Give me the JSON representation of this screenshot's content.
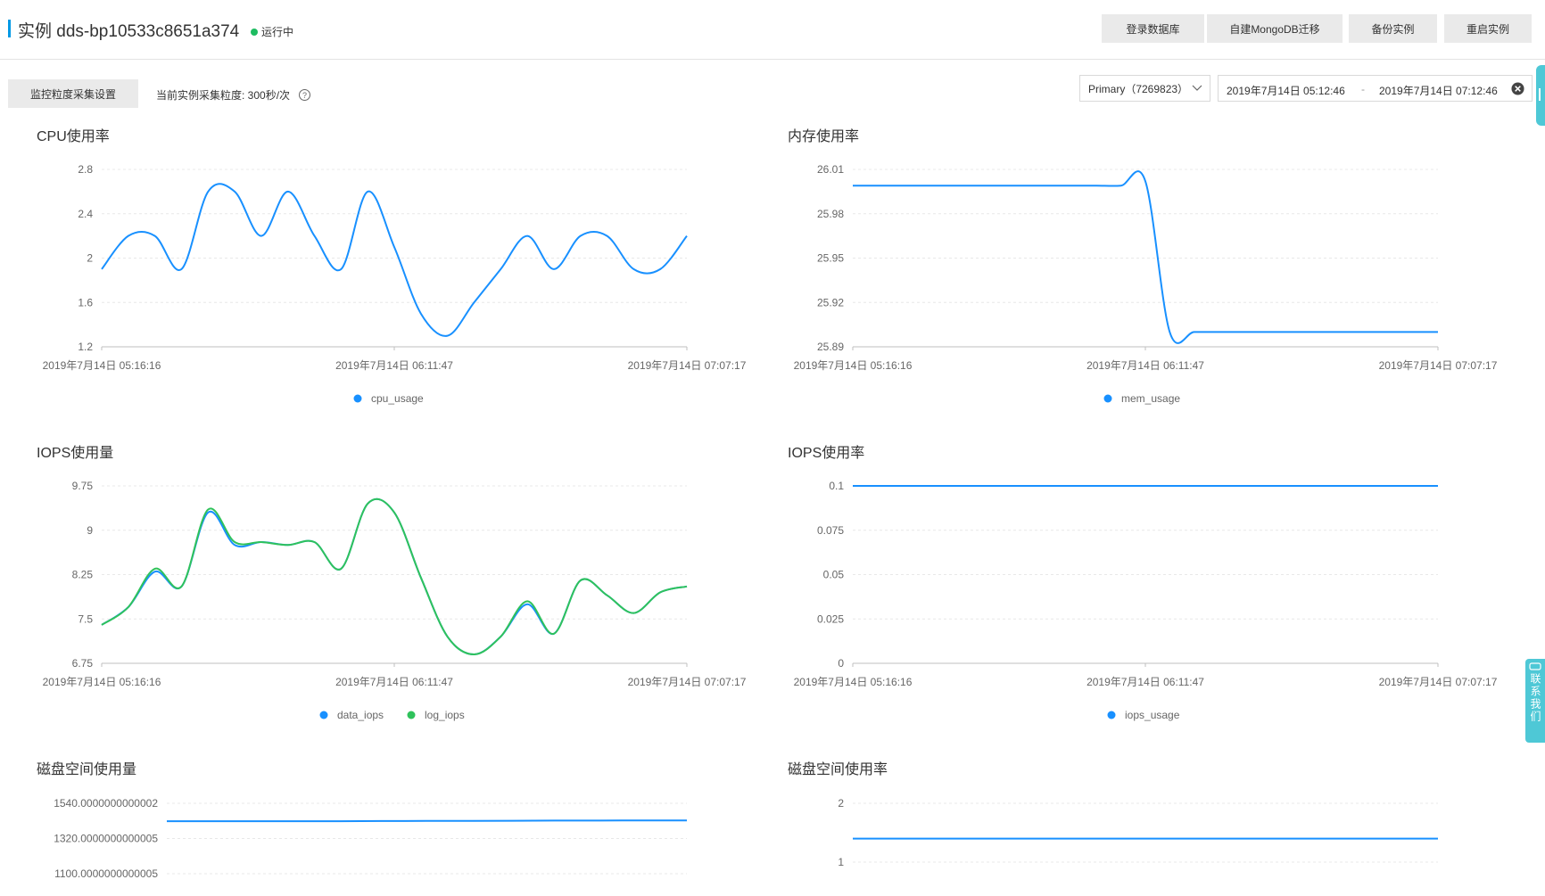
{
  "header": {
    "title": "实例 dds-bp10533c8651a374",
    "status": "运行中",
    "status_color": "#1ebc61",
    "accent_color": "#0099e5",
    "buttons": [
      {
        "label": "登录数据库"
      },
      {
        "label": "自建MongoDB迁移"
      },
      {
        "label": "备份实例"
      },
      {
        "label": "重启实例"
      }
    ]
  },
  "toolbar": {
    "settings_button": "监控粒度采集设置",
    "granularity": "当前实例采集粒度: 300秒/次",
    "help_icon": "question-circle-icon",
    "node_select": "Primary（7269823）",
    "date_start": "2019年7月14日 05:12:46",
    "date_sep": "-",
    "date_end": "2019年7月14日 07:12:46",
    "clear_icon": "clear-circle-icon"
  },
  "contact": {
    "label": "联系我们",
    "icon": "chat-icon"
  },
  "chart_data": [
    {
      "id": "cpu",
      "type": "line",
      "title": "CPU使用率",
      "yticks": [
        "1.2",
        "1.6",
        "2",
        "2.4",
        "2.8"
      ],
      "ylim": [
        1.2,
        2.8
      ],
      "xlabels": [
        "2019年7月14日 05:16:16",
        "2019年7月14日 06:11:47",
        "2019年7月14日 07:07:17"
      ],
      "series": [
        {
          "name": "cpu_usage",
          "color": "#1890ff",
          "values": [
            1.9,
            2.2,
            2.2,
            1.9,
            2.6,
            2.6,
            2.2,
            2.6,
            2.2,
            1.9,
            2.6,
            2.1,
            1.5,
            1.3,
            1.6,
            1.9,
            2.2,
            1.9,
            2.2,
            2.2,
            1.9,
            1.9,
            2.2
          ]
        }
      ]
    },
    {
      "id": "mem",
      "type": "line",
      "title": "内存使用率",
      "yticks": [
        "25.89",
        "25.92",
        "25.95",
        "25.98",
        "26.01"
      ],
      "ylim": [
        25.89,
        26.01
      ],
      "xlabels": [
        "2019年7月14日 05:16:16",
        "2019年7月14日 06:11:47",
        "2019年7月14日 07:07:17"
      ],
      "series": [
        {
          "name": "mem_usage",
          "color": "#1890ff",
          "values": [
            25.999,
            25.999,
            25.999,
            25.999,
            25.999,
            25.999,
            25.999,
            25.999,
            25.999,
            25.999,
            25.999,
            25.999,
            26.002,
            25.9,
            25.9,
            25.9,
            25.9,
            25.9,
            25.9,
            25.9,
            25.9,
            25.9,
            25.9,
            25.9,
            25.9
          ]
        }
      ]
    },
    {
      "id": "iops",
      "type": "line",
      "title": "IOPS使用量",
      "yticks": [
        "6.75",
        "7.5",
        "8.25",
        "9",
        "9.75"
      ],
      "ylim": [
        6.75,
        9.75
      ],
      "xlabels": [
        "2019年7月14日 05:16:16",
        "2019年7月14日 06:11:47",
        "2019年7月14日 07:07:17"
      ],
      "series": [
        {
          "name": "data_iops",
          "color": "#1890ff",
          "values": [
            7.4,
            7.7,
            8.3,
            8.05,
            9.3,
            8.75,
            8.8,
            8.75,
            8.8,
            8.35,
            9.45,
            9.3,
            8.2,
            7.2,
            6.9,
            7.2,
            7.75,
            7.25,
            8.15,
            7.9,
            7.6,
            7.95,
            8.05
          ]
        },
        {
          "name": "log_iops",
          "color": "#2fc25b",
          "values": [
            7.4,
            7.7,
            8.35,
            8.05,
            9.35,
            8.8,
            8.8,
            8.75,
            8.8,
            8.35,
            9.45,
            9.3,
            8.2,
            7.2,
            6.9,
            7.2,
            7.8,
            7.25,
            8.15,
            7.9,
            7.6,
            7.95,
            8.05
          ]
        }
      ]
    },
    {
      "id": "iopsrate",
      "type": "line",
      "title": "IOPS使用率",
      "yticks": [
        "0",
        "0.025",
        "0.05",
        "0.075",
        "0.1"
      ],
      "ylim": [
        0,
        0.1
      ],
      "xlabels": [
        "2019年7月14日 05:16:16",
        "2019年7月14日 06:11:47",
        "2019年7月14日 07:07:17"
      ],
      "series": [
        {
          "name": "iops_usage",
          "color": "#1890ff",
          "values": [
            0.1,
            0.1,
            0.1,
            0.1,
            0.1,
            0.1,
            0.1,
            0.1,
            0.1,
            0.1,
            0.1,
            0.1,
            0.1,
            0.1,
            0.1,
            0.1,
            0.1,
            0.1,
            0.1,
            0.1,
            0.1,
            0.1,
            0.1
          ]
        }
      ]
    },
    {
      "id": "disk",
      "type": "line",
      "title": "磁盘空间使用量",
      "yticks": [
        "1100.0000000000005",
        "1320.0000000000005",
        "1540.0000000000002"
      ],
      "ylim": [
        1100,
        1540
      ],
      "xlabels": [],
      "series": [
        {
          "name": "",
          "color": "#1890ff",
          "values": [
            1428,
            1428,
            1428,
            1428,
            1428,
            1429,
            1430,
            1430,
            1431,
            1432,
            1432,
            1433,
            1433
          ]
        }
      ]
    },
    {
      "id": "diskrate",
      "type": "line",
      "title": "磁盘空间使用率",
      "yticks": [
        "1",
        "2"
      ],
      "ylim": [
        1,
        2
      ],
      "xlabels": [],
      "series": [
        {
          "name": "",
          "color": "#1890ff",
          "values": [
            1.4,
            1.4,
            1.4,
            1.4,
            1.4,
            1.4,
            1.4,
            1.4,
            1.4,
            1.4,
            1.4,
            1.4,
            1.4
          ]
        }
      ]
    }
  ]
}
